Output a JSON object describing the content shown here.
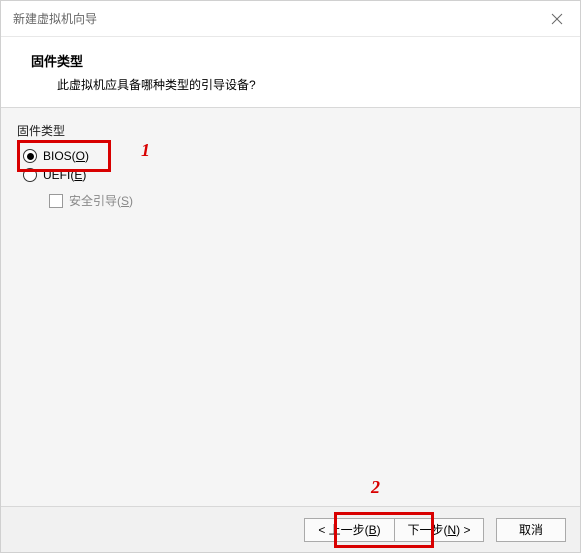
{
  "window": {
    "title": "新建虚拟机向导"
  },
  "header": {
    "heading": "固件类型",
    "subheading": "此虚拟机应具备哪种类型的引导设备?"
  },
  "group": {
    "label": "固件类型"
  },
  "options": {
    "bios": {
      "label_pre": "BIOS(",
      "hotkey": "O",
      "label_post": ")",
      "selected": true
    },
    "uefi": {
      "label_pre": "UEFI(",
      "hotkey": "E",
      "label_post": ")",
      "selected": false
    },
    "secure_boot": {
      "label_pre": "安全引导(",
      "hotkey": "S",
      "label_post": ")",
      "checked": false,
      "enabled": false
    }
  },
  "buttons": {
    "back_pre": "< 上一步(",
    "back_hotkey": "B",
    "back_post": ")",
    "next_pre": "下一步(",
    "next_hotkey": "N",
    "next_post": ") >",
    "cancel": "取消"
  },
  "annotations": {
    "a1": "1",
    "a2": "2"
  }
}
